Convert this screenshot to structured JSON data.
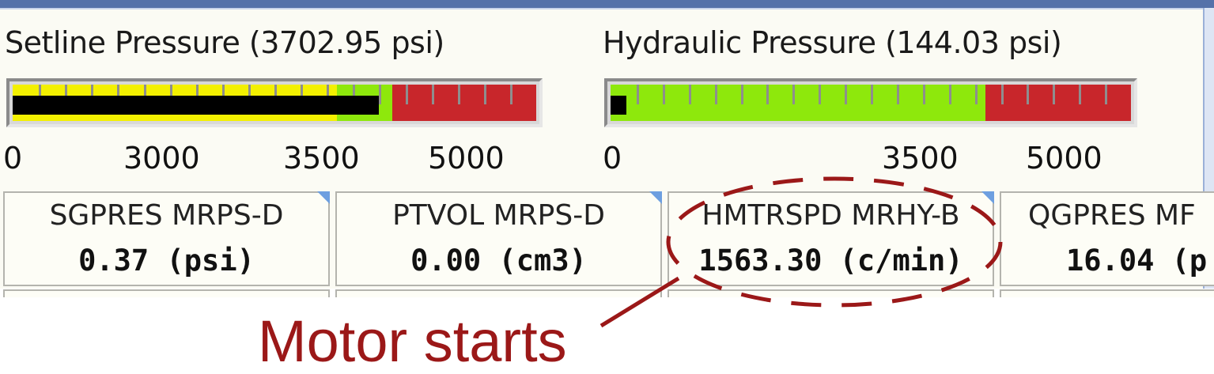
{
  "gauges": [
    {
      "title": "Setline Pressure (3702.95 psi)",
      "value": 3702.95,
      "unit": "psi",
      "fill_fraction": 0.7,
      "zones": [
        {
          "color": "#f3f000",
          "from": 0.0,
          "to": 0.62
        },
        {
          "color": "#8ee80c",
          "from": 0.62,
          "to": 0.725
        },
        {
          "color": "#c8262b",
          "from": 0.725,
          "to": 1.0
        }
      ],
      "tick_labels": [
        "0",
        "3000",
        "3500",
        "5000"
      ]
    },
    {
      "title": "Hydraulic Pressure (144.03 psi)",
      "value": 144.03,
      "unit": "psi",
      "fill_fraction": 0.03,
      "zones": [
        {
          "color": "#8ee80c",
          "from": 0.0,
          "to": 0.72
        },
        {
          "color": "#c8262b",
          "from": 0.72,
          "to": 1.0
        }
      ],
      "tick_labels": [
        "0",
        "3500",
        "5000"
      ]
    }
  ],
  "channels": [
    {
      "name": "SGPRES MRPS-D",
      "value": "0.37 (psi)"
    },
    {
      "name": "PTVOL MRPS-D",
      "value": "0.00 (cm3)"
    },
    {
      "name": "HMTRSPD MRHY-B",
      "value": "1563.30 (c/min)"
    },
    {
      "name": "QGPRES MF",
      "value": "16.04 (p"
    }
  ],
  "annotation": {
    "text": "Motor starts",
    "color": "#9b1818",
    "target": "HMTRSPD MRHY-B"
  },
  "colors": {
    "titlebar": "#5571a9",
    "panel_background": "#fbfbf4",
    "cell_corner_marker": "#6d9fe0"
  }
}
